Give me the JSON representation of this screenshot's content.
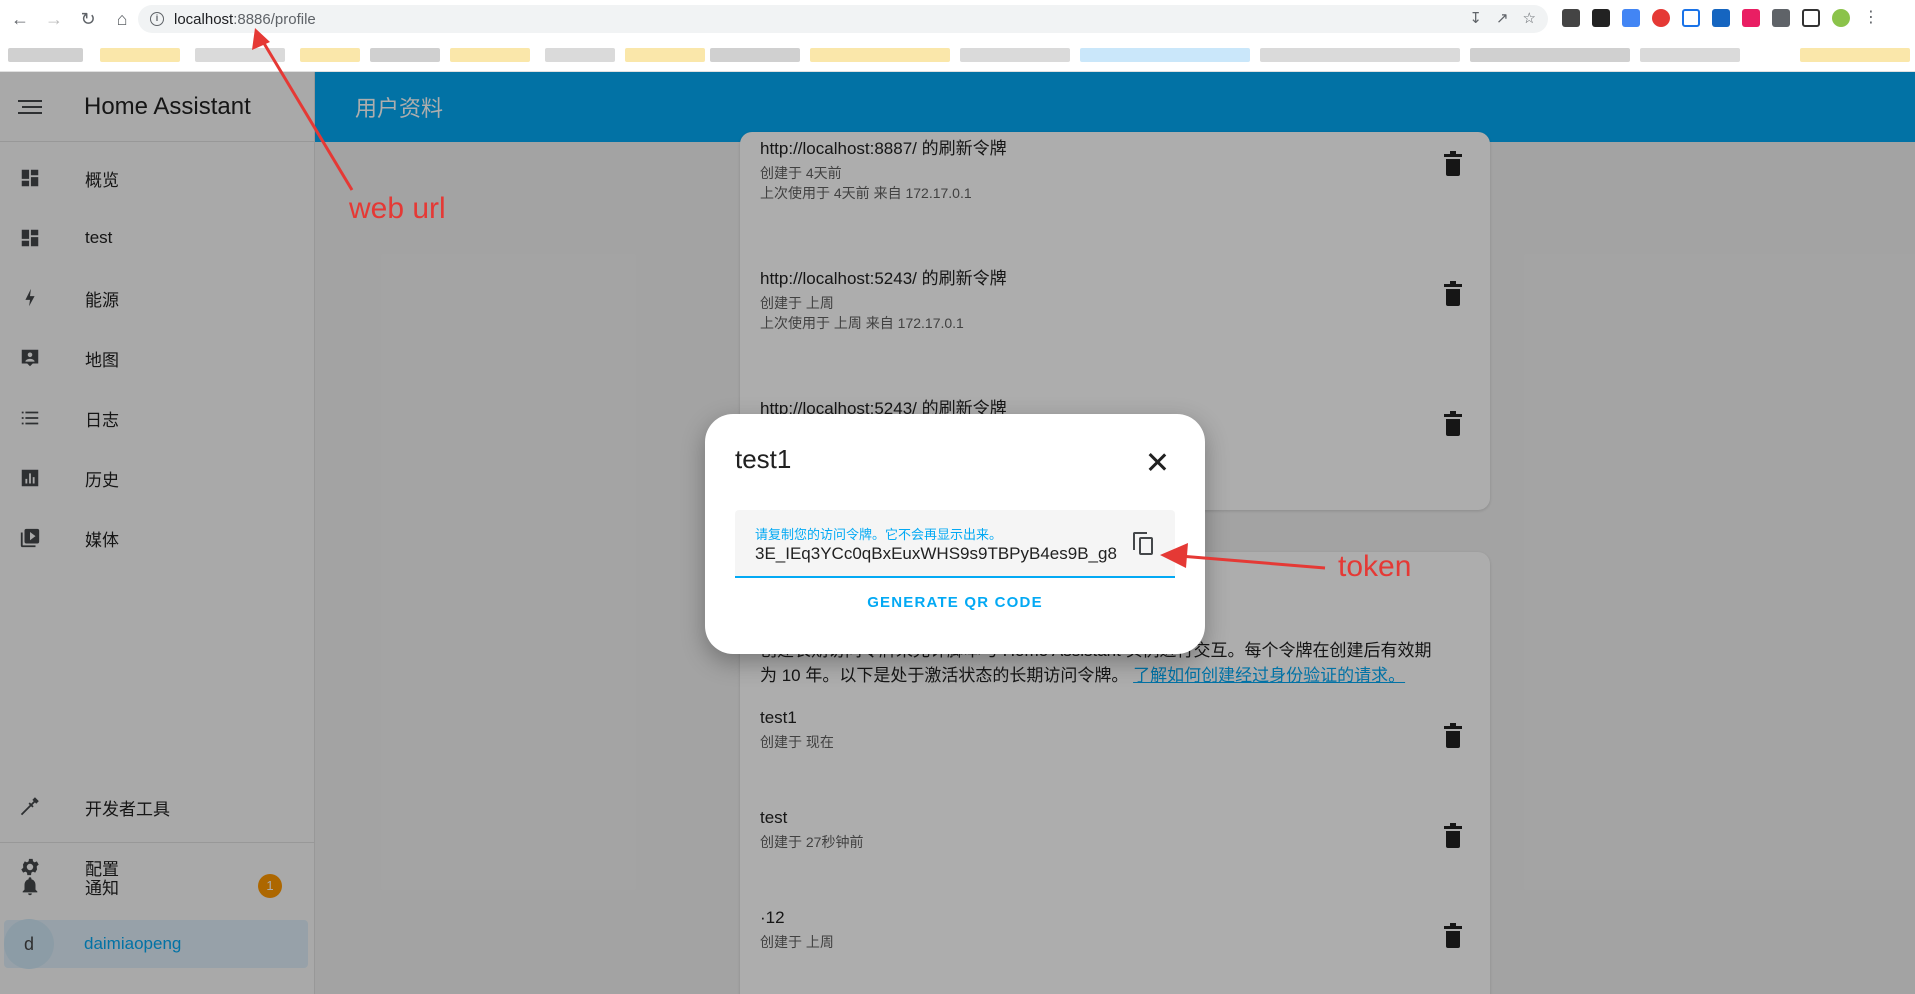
{
  "browser": {
    "url_host": "localhost",
    "url_rest": ":8886/profile"
  },
  "sidebar": {
    "title": "Home Assistant",
    "items": [
      {
        "label": "概览",
        "icon": "dashboard-icon"
      },
      {
        "label": "test",
        "icon": "dashboard-icon"
      },
      {
        "label": "能源",
        "icon": "lightning-icon"
      },
      {
        "label": "地图",
        "icon": "map-account-icon"
      },
      {
        "label": "日志",
        "icon": "list-icon"
      },
      {
        "label": "历史",
        "icon": "chart-box-icon"
      },
      {
        "label": "媒体",
        "icon": "media-play-icon"
      }
    ],
    "dev_tools": "开发者工具",
    "config": "配置",
    "notifications": "通知",
    "notification_count": "1",
    "user_initial": "d",
    "user_name": "daimiaopeng"
  },
  "toolbar": {
    "title": "用户资料"
  },
  "refresh_tokens": [
    {
      "title": "http://localhost:8887/ 的刷新令牌",
      "created": "创建于 4天前",
      "last_used": "上次使用于 4天前 来自 172.17.0.1"
    },
    {
      "title": "http://localhost:5243/ 的刷新令牌",
      "created": "创建于 上周",
      "last_used": "上次使用于 上周 来自 172.17.0.1"
    },
    {
      "title": "http://localhost:5243/ 的刷新令牌"
    }
  ],
  "long_lived": {
    "description_line1": "创建长期访问令牌来允许脚本与 Home Assistant 实例进行交互。每个令牌在创建后有效期",
    "description_line2": "为 10 年。以下是处于激活状态的长期访问令牌。",
    "learn_link": "了解如何创建经过身份验证的请求。",
    "tokens": [
      {
        "title": "test1",
        "created": "创建于 现在"
      },
      {
        "title": "test",
        "created": "创建于 27秒钟前"
      },
      {
        "title": "·12",
        "created": "创建于 上周"
      }
    ]
  },
  "dialog": {
    "title": "test1",
    "field_label": "请复制您的访问令牌。它不会再显示出来。",
    "token_value": "3E_IEq3YCc0qBxEuxWHS9s9TBPyB4es9B_g8",
    "qr_button": "GENERATE QR CODE"
  },
  "annotations": {
    "web_url": "web url",
    "token": "token",
    "color": "#e53935"
  }
}
